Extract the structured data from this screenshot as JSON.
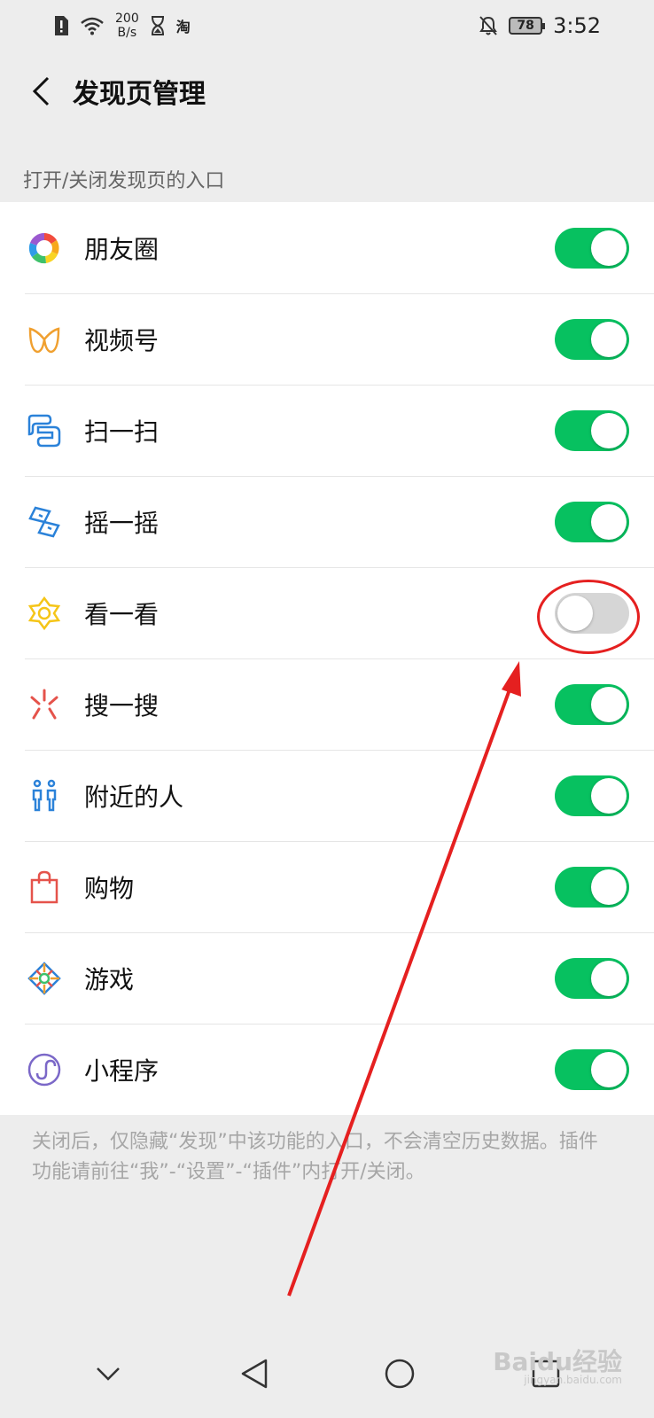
{
  "status_bar": {
    "net_speed_value": "200",
    "net_speed_unit": "B/s",
    "taobao_glyph": "淘",
    "battery": "78",
    "time": "3:52"
  },
  "header": {
    "title": "发现页管理"
  },
  "section": {
    "header": "打开/关闭发现页的入口"
  },
  "items": [
    {
      "label": "朋友圈",
      "icon": "moments-icon",
      "on": true
    },
    {
      "label": "视频号",
      "icon": "channels-icon",
      "on": true
    },
    {
      "label": "扫一扫",
      "icon": "scan-icon",
      "on": true
    },
    {
      "label": "摇一摇",
      "icon": "shake-icon",
      "on": true
    },
    {
      "label": "看一看",
      "icon": "top-stories-icon",
      "on": false
    },
    {
      "label": "搜一搜",
      "icon": "search-icon",
      "on": true
    },
    {
      "label": "附近的人",
      "icon": "people-nearby-icon",
      "on": true
    },
    {
      "label": "购物",
      "icon": "shopping-bag-icon",
      "on": true
    },
    {
      "label": "游戏",
      "icon": "games-icon",
      "on": true
    },
    {
      "label": "小程序",
      "icon": "mini-programs-icon",
      "on": true
    }
  ],
  "footer": {
    "note": "关闭后，仅隐藏“发现”中该功能的入口，不会清空历史数据。插件功能请前往“我”-“设置”-“插件”内打开/关闭。"
  },
  "watermark": {
    "main": "Baidu经验",
    "sub": "jingyan.baidu.com"
  },
  "colors": {
    "accent": "#07c160",
    "toggle_off": "#d6d6d6",
    "annotation": "#e52020",
    "background": "#ededed"
  }
}
